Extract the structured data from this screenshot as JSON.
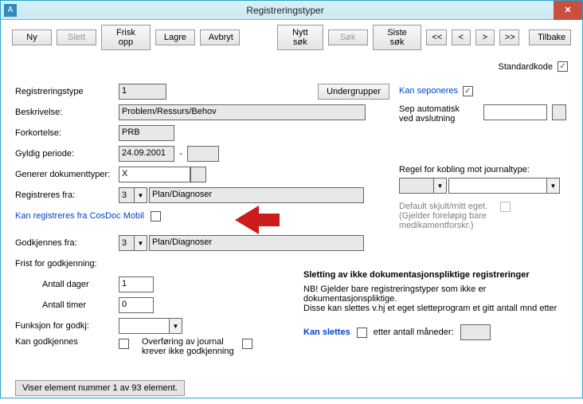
{
  "app_icon": "A",
  "title": "Registreringstyper",
  "close_glyph": "✕",
  "toolbar": {
    "ny": "Ny",
    "slett": "Slett",
    "frisk_opp": "Frisk opp",
    "lagre": "Lagre",
    "avbryt": "Avbryt",
    "nytt_sok": "Nytt søk",
    "sok": "Søk",
    "siste_sok": "Siste søk",
    "first": "<<",
    "prev": "<",
    "next": ">",
    "last": ">>",
    "tilbake": "Tilbake"
  },
  "standardkode": {
    "label": "Standardkode",
    "checked": true
  },
  "left": {
    "registreringstype": {
      "label": "Registreringstype",
      "value": "1"
    },
    "undergrupper_btn": "Undergrupper",
    "beskrivelse": {
      "label": "Beskrivelse:",
      "value": "Problem/Ressurs/Behov"
    },
    "forkortelse": {
      "label": "Forkortelse:",
      "value": "PRB"
    },
    "gyldig_periode": {
      "label": "Gyldig periode:",
      "from": "24.09.2001",
      "dash": "-",
      "to": ""
    },
    "generer_dok": {
      "label": "Generer dokumenttyper:",
      "value": "X"
    },
    "registreres_fra": {
      "label": "Registreres fra:",
      "num": "3",
      "text": "Plan/Diagnoser"
    },
    "kan_reg_mobil": {
      "label": "Kan registreres fra CosDoc Mobil",
      "checked": false
    },
    "godkjennes_fra": {
      "label": "Godkjennes fra:",
      "num": "3",
      "text": "Plan/Diagnoser"
    },
    "frist_label": "Frist for godkjenning:",
    "antall_dager": {
      "label": "Antall dager",
      "value": "1"
    },
    "antall_timer": {
      "label": "Antall timer",
      "value": "0"
    },
    "funksjon_godkj": {
      "label": "Funksjon for godkj:",
      "value": ""
    },
    "kan_godkjennes": {
      "label": "Kan godkjennes",
      "checked": false
    },
    "overforing": {
      "label1": "Overføring av journal",
      "label2": "krever ikke godkjenning",
      "checked": false
    }
  },
  "right": {
    "kan_seponeres": {
      "label": "Kan seponeres",
      "checked": true
    },
    "sep_auto": {
      "label1": "Sep automatisk",
      "label2": "ved avslutning",
      "value": ""
    },
    "regel_kobling": {
      "label": "Regel for kobling mot journaltype:",
      "sel1": "",
      "sel2": ""
    },
    "default_skjult": {
      "line1": "Default skjult/mitt eget.",
      "line2": "(Gjelder foreløpig bare",
      "line3": "medikamentforskr.)",
      "checked": false
    },
    "sletting": {
      "title": "Sletting av ikke dokumentasjonspliktige registreringer",
      "info1": "NB! Gjelder bare registreringstyper som ikke er dokumentasjonspliktige.",
      "info2": "Disse kan slettes v.hj et eget sletteprogram et gitt antall mnd etter",
      "kan_slettes": "Kan slettes",
      "kan_slettes_checked": false,
      "etter_label": "etter antall måneder:",
      "etter_value": ""
    }
  },
  "status": "Viser element nummer 1 av 93 element.",
  "check_glyph": "✓",
  "tri_down": "▼"
}
